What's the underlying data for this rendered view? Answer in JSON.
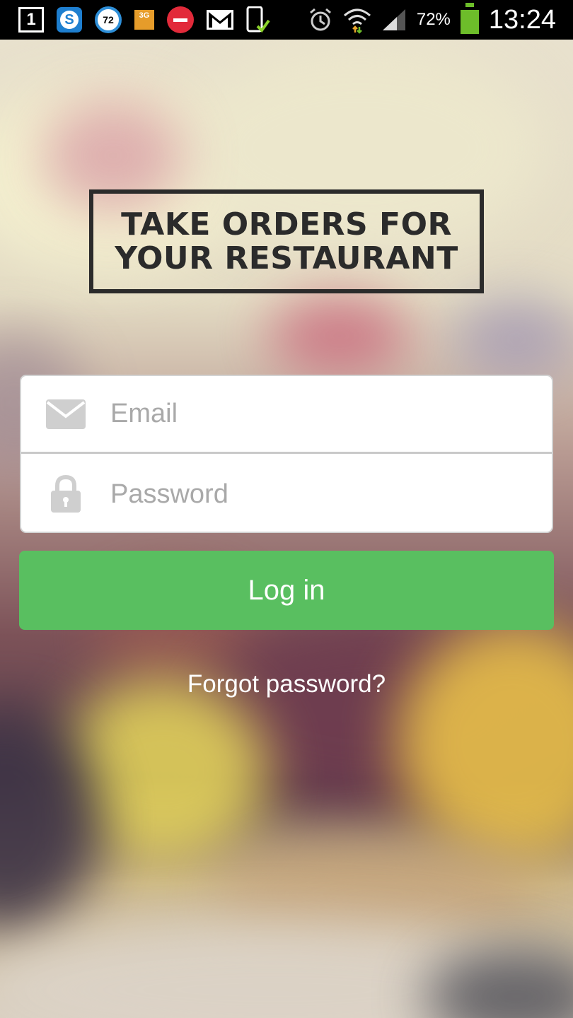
{
  "status_bar": {
    "sim_label": "1",
    "skype_label": "S",
    "badge_number": "72",
    "network_label": "3G",
    "battery_percent": "72%",
    "time": "13:24"
  },
  "logo": {
    "line1": "TAKE ORDERS FOR",
    "line2": "YOUR RESTAURANT"
  },
  "login_form": {
    "email_placeholder": "Email",
    "email_value": "",
    "password_placeholder": "Password",
    "password_value": ""
  },
  "login_button_label": "Log in",
  "forgot_password_label": "Forgot password?",
  "colors": {
    "login_button": "#59bf60",
    "logo_text": "#2b2b2b",
    "placeholder": "#a9a9a9"
  }
}
